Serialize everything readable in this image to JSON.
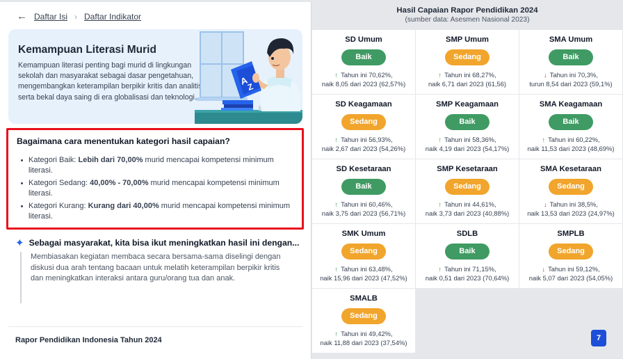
{
  "breadcrumb": {
    "back_icon": "arrow-left-icon",
    "item1": "Daftar Isi",
    "item2": "Daftar Indikator"
  },
  "hero": {
    "title": "Kemampuan Literasi Murid",
    "description": "Kemampuan literasi penting bagi murid di lingkungan sekolah dan masyarakat sebagai dasar pengetahuan, mengembangkan keterampilan berpikir kritis dan analitis, serta bekal daya saing di era globalisasi dan teknologi.",
    "book_letters": [
      "A",
      "Z"
    ]
  },
  "criteria": {
    "title": "Bagaimana cara menentukan kategori hasil capaian?",
    "items": [
      {
        "prefix": "Kategori Baik: ",
        "bold": "Lebih dari 70,00%",
        "suffix": " murid mencapai kompetensi minimum literasi."
      },
      {
        "prefix": "Kategori Sedang: ",
        "bold": "40,00% - 70,00%",
        "suffix": " murid mencapai kompetensi minimum literasi."
      },
      {
        "prefix": "Kategori Kurang: ",
        "bold": "Kurang dari 40,00%",
        "suffix": " murid mencapai kompetensi minimum literasi."
      }
    ]
  },
  "insight": {
    "title": "Sebagai masyarakat, kita bisa ikut meningkatkan hasil ini dengan...",
    "body": "Membiasakan kegiatan membaca secara bersama-sama diselingi dengan diskusi dua arah tentang bacaan untuk melatih keterampilan berpikir kritis dan meningkatkan interaksi antara guru/orang tua dan anak."
  },
  "footer": {
    "title": "Rapor Pendidikan Indonesia Tahun 2024"
  },
  "report": {
    "title": "Hasil Capaian Rapor Pendidikan 2024",
    "subtitle": "(sumber data: Asesmen Nasional 2023)"
  },
  "colors": {
    "baik": "#3f9b63",
    "sedang": "#f1a52c",
    "up": "#2f8f57",
    "down": "#dc2626",
    "highlight_border": "#e8101c"
  },
  "cards": [
    {
      "name": "SD Umum",
      "category": "Baik",
      "trend": "up",
      "line1": "Tahun ini 70,62%,",
      "line2": "naik 8,05 dari 2023 (62,57%)"
    },
    {
      "name": "SMP Umum",
      "category": "Sedang",
      "trend": "up",
      "line1": "Tahun ini 68,27%,",
      "line2": "naik 6,71 dari 2023 (61,56)"
    },
    {
      "name": "SMA Umum",
      "category": "Baik",
      "trend": "down",
      "line1": "Tahun ini 70,3%,",
      "line2": "turun 8,54 dari 2023 (59,1%)"
    },
    {
      "name": "SD Keagamaan",
      "category": "Sedang",
      "trend": "up",
      "line1": "Tahun ini 56,93%,",
      "line2": "naik 2,67 dari 2023 (54,26%)"
    },
    {
      "name": "SMP Keagamaan",
      "category": "Baik",
      "trend": "up",
      "line1": "Tahun ini 58,36%,",
      "line2": "naik 4,19 dari 2023 (54,17%)"
    },
    {
      "name": "SMA Keagamaan",
      "category": "Baik",
      "trend": "up",
      "line1": "Tahun ini 60,22%,",
      "line2": "naik 11,53 dari 2023 (48,69%)"
    },
    {
      "name": "SD Kesetaraan",
      "category": "Baik",
      "trend": "up",
      "line1": "Tahun ini 60,46%,",
      "line2": "naik 3,75 dari 2023 (56,71%)"
    },
    {
      "name": "SMP Kesetaraan",
      "category": "Sedang",
      "trend": "up",
      "line1": "Tahun ini 44,61%,",
      "line2": "naik 3,73 dari 2023 (40,88%)"
    },
    {
      "name": "SMA Kesetaraan",
      "category": "Sedang",
      "trend": "down",
      "line1": "Tahun ini 38,5%,",
      "line2": "naik 13,53 dari 2023 (24,97%)"
    },
    {
      "name": "SMK Umum",
      "category": "Sedang",
      "trend": "up",
      "line1": "Tahun ini 63,48%,",
      "line2": "naik 15,96 dari 2023 (47,52%)"
    },
    {
      "name": "SDLB",
      "category": "Baik",
      "trend": "up",
      "line1": "Tahun ini 71,15%,",
      "line2": "naik 0,51 dari 2023 (70,64%)"
    },
    {
      "name": "SMPLB",
      "category": "Sedang",
      "trend": "down",
      "line1": "Tahun ini 59,12%,",
      "line2": "naik 5,07 dari 2023 (54,05%)"
    },
    {
      "name": "SMALB",
      "category": "Sedang",
      "trend": "up",
      "line1": "Tahun ini 49,42%,",
      "line2": "naik 11,88 dari 2023 (37,54%)"
    }
  ],
  "fab": {
    "label": "7"
  }
}
